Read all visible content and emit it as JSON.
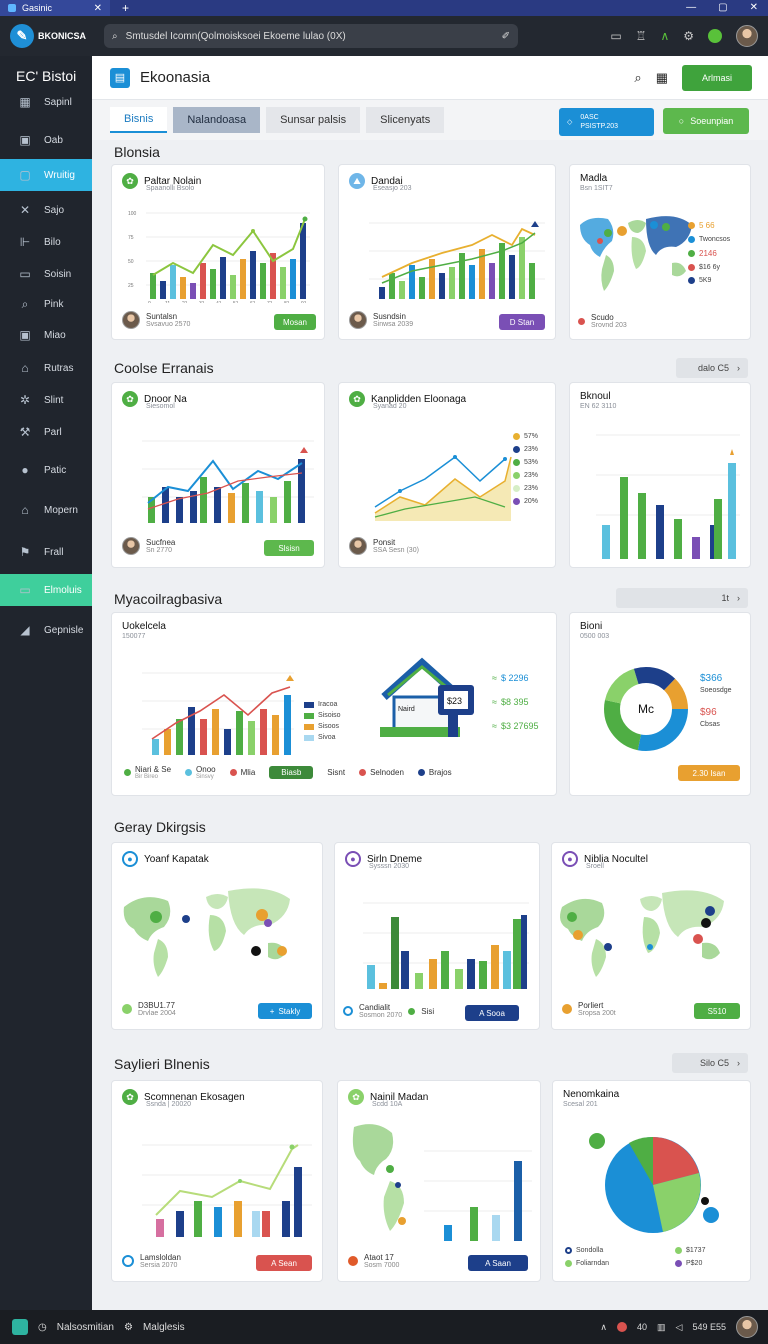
{
  "titlebar": {
    "tab_label": "Gasinic",
    "close": "✕",
    "plus": "+"
  },
  "topbar": {
    "logo_text": "BKONICSA",
    "address": "Smtusdel Icomn(Qolmoisksoei Ekoeme lulao (0X)"
  },
  "sidebar": {
    "brand": "EC' Bistoi",
    "items": [
      {
        "label": "Sapinl",
        "icon": "grid-icon"
      },
      {
        "label": "Oab",
        "icon": "lock-icon"
      },
      {
        "label": "Wruitig",
        "icon": "square-icon"
      },
      {
        "label": "Sajo",
        "icon": "cross-icon"
      },
      {
        "label": "Bilo",
        "icon": "ruler-icon"
      },
      {
        "label": "Soisin",
        "icon": "chat-icon"
      },
      {
        "label": "Pink",
        "icon": "search-icon"
      },
      {
        "label": "Miao",
        "icon": "image-icon"
      },
      {
        "label": "Rutras",
        "icon": "home-icon"
      },
      {
        "label": "Slint",
        "icon": "sun-icon"
      },
      {
        "label": "Parl",
        "icon": "tools-icon"
      },
      {
        "label": "Patic",
        "icon": "info-icon"
      },
      {
        "label": "Mopern",
        "icon": "house-icon"
      },
      {
        "label": "Frall",
        "icon": "flag-icon"
      },
      {
        "label": "Elmoluis",
        "icon": "panel-icon"
      },
      {
        "label": "Gepnisle",
        "icon": "chart-icon"
      }
    ]
  },
  "header": {
    "title": "Ekoonasia",
    "button": "Arlmasi"
  },
  "tabs": [
    "Bisnis",
    "Nalandoasa",
    "Sunsar palsis",
    "Slicenyats"
  ],
  "actions": {
    "btn1_line1": "0ASC",
    "btn1_line2": "PSISTP.203",
    "btn2": "Soeunpian"
  },
  "sections": [
    {
      "title": "Blonsia"
    },
    {
      "title": "Coolse Erranais",
      "btn": "dalo C5"
    },
    {
      "title": "Myacoilragbasiva",
      "btn": "1t"
    },
    {
      "title": "Geray Dkirgsis"
    },
    {
      "title": "Saylieri Blnenis",
      "btn": "Silo C5"
    }
  ],
  "cards": {
    "c1": {
      "title": "Paltar Nolain",
      "sub": "Spaanolli Bsolo",
      "footer_name": "Suntalsn",
      "footer_sub": "Svsavuo 2570",
      "pill": "Mosan",
      "ticks": [
        "0",
        "11",
        "21",
        "31",
        "41",
        "51",
        "61",
        "71",
        "81",
        "91"
      ]
    },
    "c2": {
      "title": "Dandai",
      "sub": "Eseasjo 203",
      "footer_name": "Susndsin",
      "footer_sub": "Sinwsa 2039",
      "pill": "D Stan"
    },
    "c3": {
      "title": "Madla",
      "sub": "Bsn 1SIT7",
      "legend": [
        "5 66",
        "Twoncsos",
        "2146",
        "$16 6y",
        "5K9"
      ],
      "footer_name": "Scudo",
      "footer_sub": "Srovnd 203"
    },
    "c4": {
      "title": "Dnoor Na",
      "sub": "Siesomol",
      "footer_name": "Sucfnea",
      "footer_sub": "Sn 2770",
      "pill": "Slsisn"
    },
    "c5": {
      "title": "Kanplidden Eloonaga",
      "sub": "Syanad 20",
      "legend": [
        "57%",
        "23%",
        "53%",
        "23%",
        "23%",
        "20%"
      ],
      "footer_name": "Ponsit",
      "footer_sub": "SSA Sesn (30)"
    },
    "c6": {
      "title": "Bknoul",
      "sub": "EN 62 3110"
    },
    "c7": {
      "title": "Uokelcela",
      "sub": "150077",
      "legend": [
        "Iracoa",
        "Sisoiso",
        "Sisoos",
        "Sivoa"
      ],
      "values": [
        "$ 2296",
        "$8 395",
        "$3 27695"
      ],
      "sign": "Naird",
      "screen": "$23",
      "footer": [
        "Niari & Se",
        "Onoo",
        "Mlia",
        "Sisnt",
        "Selnoden",
        "Brajos"
      ],
      "footer_subs": [
        "Bir Bireo",
        "Sinsvy"
      ],
      "pill": "Biasb"
    },
    "c8": {
      "title": "Bioni",
      "sub": "0500 003",
      "center": "Mc",
      "values": [
        "$366",
        "Soeosdge",
        "$96",
        "Cbsas"
      ],
      "pill": "2.30 Isan"
    },
    "c9": {
      "title": "Yoanf Kapatak",
      "footer_name": "D3BU1.77",
      "footer_sub": "Drvlae 2004",
      "pill": "Stakly"
    },
    "c10": {
      "title": "Sirln Dneme",
      "sub": "Sysssn 2030",
      "footer_name": "Candialit",
      "footer_sub": "Sosmon 2070",
      "footer_extra": "Sisi",
      "pill": "A Sooa"
    },
    "c11": {
      "title": "Niblia Nocultel",
      "sub": "Sroell",
      "footer_name": "Porliert",
      "footer_sub": "Sropsa 200t",
      "pill": "S510"
    },
    "c12": {
      "title": "Scomnenan Ekosagen",
      "sub": "Ssnda | 20020",
      "footer_name": "Lamsloldan",
      "footer_sub": "Sersia 2070",
      "pill": "A Sean"
    },
    "c13": {
      "title": "Nainil Madan",
      "sub": "Scdd 10A",
      "footer_name": "Ataot 17",
      "footer_sub": "Sosm 7000",
      "pill": "A Saan"
    },
    "c14": {
      "title": "Nenomkaina",
      "sub": "Scesal 201",
      "legend": [
        "Sondolla",
        "$1737",
        "Foliarndan",
        "P$20"
      ]
    }
  },
  "taskbar": {
    "left1": "Nalsosmitian",
    "left2": "Malglesis",
    "clock": "549 E55",
    "lang": "40"
  },
  "colors": {
    "accent": "#1b8fd6",
    "green": "#4fae44",
    "navy": "#1d3f8a",
    "purple": "#7a4fb5",
    "orange": "#e8a030",
    "red": "#d9534f"
  }
}
